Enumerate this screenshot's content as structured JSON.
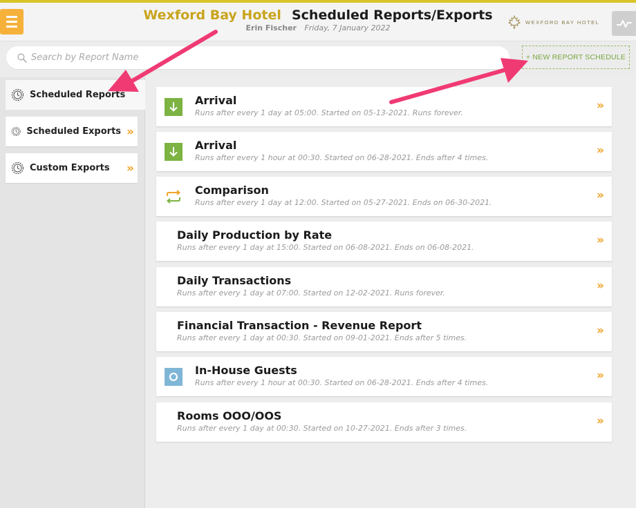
{
  "header": {
    "hotel_name": "Wexford Bay Hotel",
    "page_title": "Scheduled Reports/Exports",
    "user_name": "Erin Fischer",
    "date": "Friday, 7 January 2022",
    "logo_text": "WEXFORD BAY HOTEL",
    "accent_color": "#c9a41d",
    "menu_icon": "hamburger-menu-icon",
    "analytics_icon": "pulse-chart-icon"
  },
  "search": {
    "placeholder": "Search by Report Name",
    "value": ""
  },
  "actions": {
    "new_schedule_label": "+ NEW REPORT SCHEDULE"
  },
  "sidebar": {
    "items": [
      {
        "label": "Scheduled Reports",
        "icon": "clock-icon",
        "active": true,
        "chevron": ""
      },
      {
        "label": "Scheduled Exports",
        "icon": "clock-icon",
        "active": false,
        "chevron": "»"
      },
      {
        "label": "Custom Exports",
        "icon": "clock-icon",
        "active": false,
        "chevron": "»"
      }
    ]
  },
  "reports": [
    {
      "name": "Arrival",
      "description": "Runs after every 1 day at 05:00. Started on 05-13-2021. Runs forever.",
      "icon": "download-arrow-icon",
      "chevron": "»"
    },
    {
      "name": "Arrival",
      "description": "Runs after every 1 hour at 00:30. Started on 06-28-2021. Ends after 4 times.",
      "icon": "download-arrow-icon",
      "chevron": "»"
    },
    {
      "name": "Comparison",
      "description": "Runs after every 1 day at 12:00. Started on 05-27-2021. Ends on 06-30-2021.",
      "icon": "compare-arrows-icon",
      "chevron": "»"
    },
    {
      "name": "Daily Production by Rate",
      "description": "Runs after every 1 day at 15:00. Started on 06-08-2021. Ends on 06-08-2021.",
      "icon": "",
      "chevron": "»"
    },
    {
      "name": "Daily Transactions",
      "description": "Runs after every 1 day at 07:00. Started on 12-02-2021. Runs forever.",
      "icon": "",
      "chevron": "»"
    },
    {
      "name": "Financial Transaction - Revenue Report",
      "description": "Runs after every 1 day at 00:30. Started on 09-01-2021. Ends after 5 times.",
      "icon": "",
      "chevron": "»"
    },
    {
      "name": "In-House Guests",
      "description": "Runs after every 1 hour at 00:30. Started on 06-28-2021. Ends after 4 times.",
      "icon": "circle-status-icon",
      "chevron": "»"
    },
    {
      "name": "Rooms OOO/OOS",
      "description": "Runs after every 1 day at 00:30. Started on 10-27-2021. Ends after 3 times.",
      "icon": "",
      "chevron": "»"
    }
  ]
}
